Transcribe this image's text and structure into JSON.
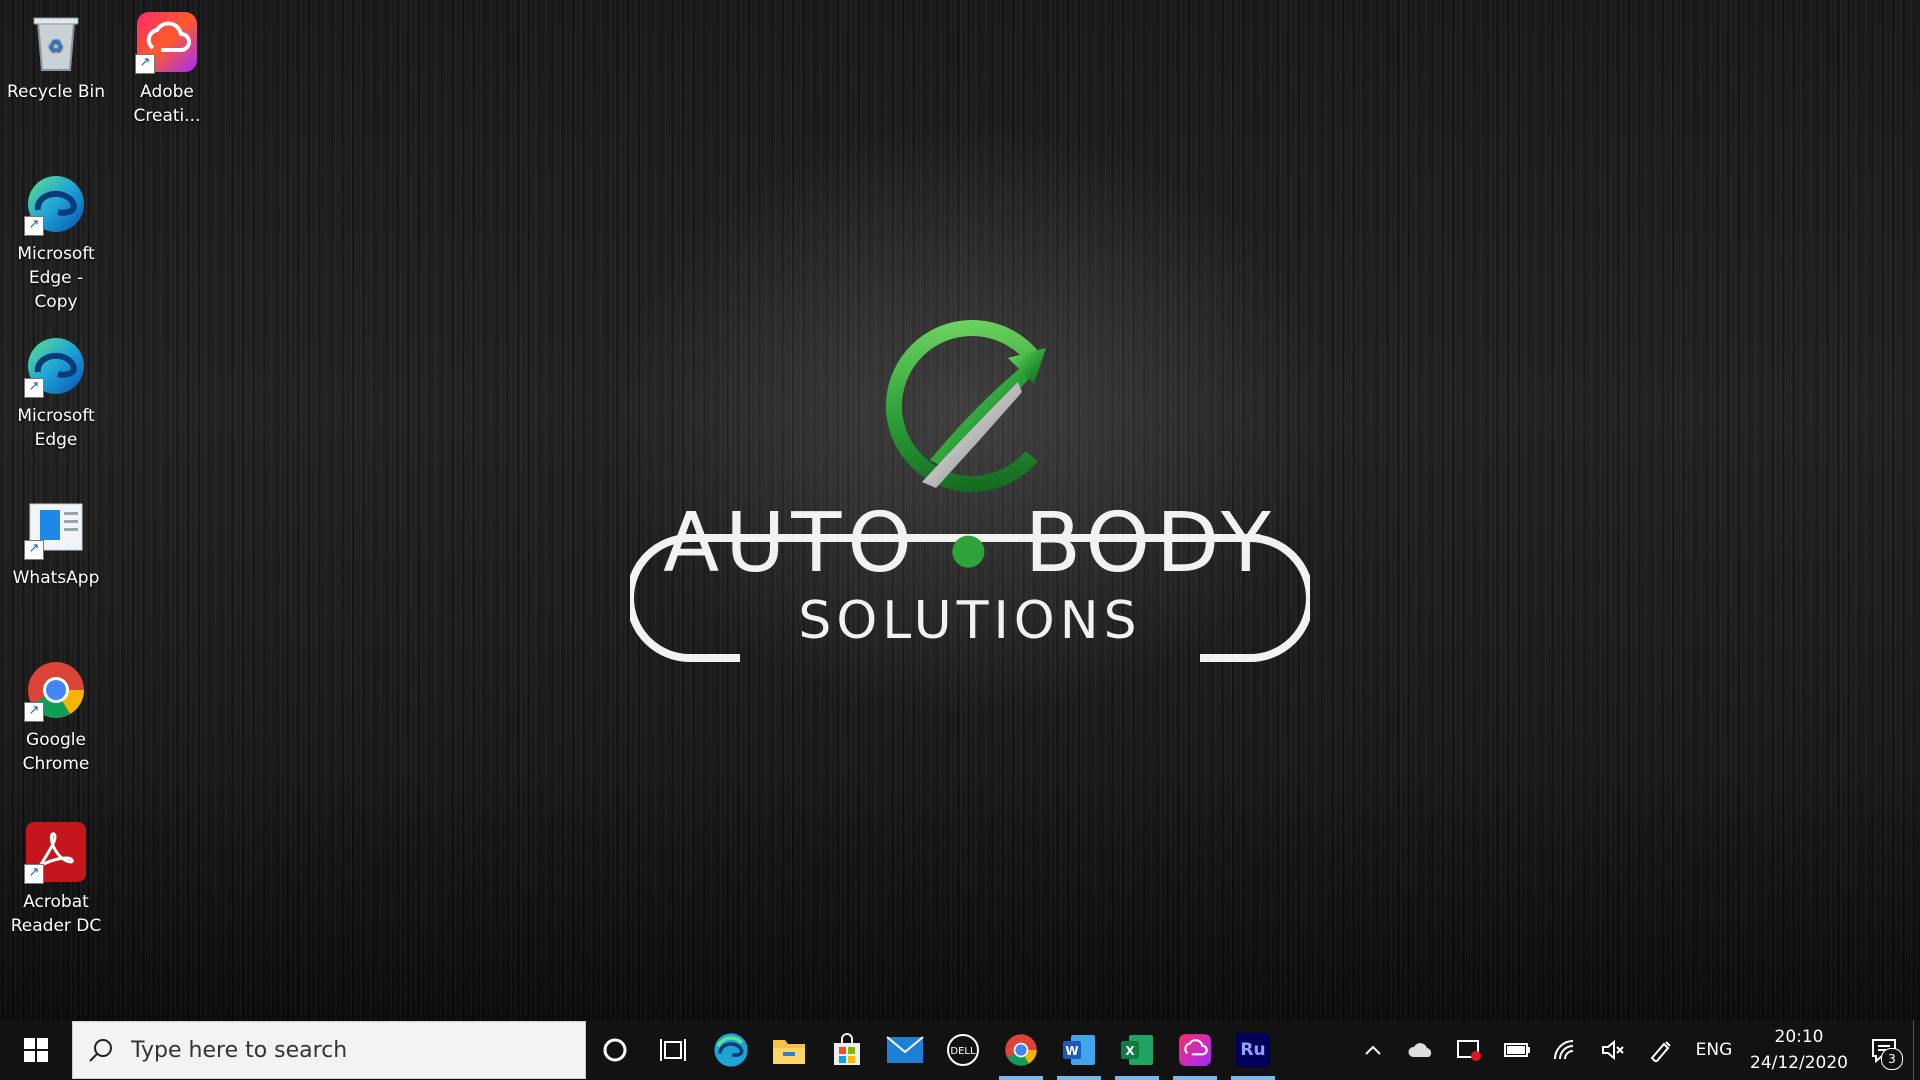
{
  "wallpaper": {
    "brand_line1_left": "AUTO",
    "brand_line1_right": "BODY",
    "brand_line2": "SOLUTIONS",
    "accent_color": "#2fa23a"
  },
  "desktop_icons": [
    {
      "label": "Recycle Bin",
      "icon": "recycle-bin-icon"
    },
    {
      "label": "Adobe Creati...",
      "icon": "adobe-creative-cloud-icon"
    },
    {
      "label": "Microsoft Edge - Copy",
      "icon": "edge-icon"
    },
    {
      "label": "Microsoft Edge",
      "icon": "edge-icon"
    },
    {
      "label": "WhatsApp",
      "icon": "whatsapp-icon"
    },
    {
      "label": "Google Chrome",
      "icon": "chrome-icon"
    },
    {
      "label": "Acrobat Reader DC",
      "icon": "acrobat-reader-icon"
    }
  ],
  "taskbar": {
    "search_placeholder": "Type here to search",
    "pinned": [
      {
        "name": "cortana",
        "icon": "cortana-icon"
      },
      {
        "name": "task-view",
        "icon": "task-view-icon"
      },
      {
        "name": "edge",
        "icon": "edge-icon"
      },
      {
        "name": "file-explorer",
        "icon": "folder-icon"
      },
      {
        "name": "microsoft-store",
        "icon": "store-icon"
      },
      {
        "name": "mail",
        "icon": "mail-icon"
      },
      {
        "name": "dell",
        "icon": "dell-icon"
      },
      {
        "name": "chrome",
        "icon": "chrome-icon",
        "active": true
      },
      {
        "name": "word",
        "icon": "word-icon",
        "active": true
      },
      {
        "name": "excel",
        "icon": "excel-icon",
        "active": true
      },
      {
        "name": "creative-cloud",
        "icon": "adobe-creative-cloud-icon",
        "active": true
      },
      {
        "name": "rush",
        "icon": "rush-icon",
        "label": "Ru",
        "active": true
      }
    ],
    "tray": {
      "language": "ENG",
      "time": "20:10",
      "date": "24/12/2020",
      "notification_count": "3"
    }
  }
}
